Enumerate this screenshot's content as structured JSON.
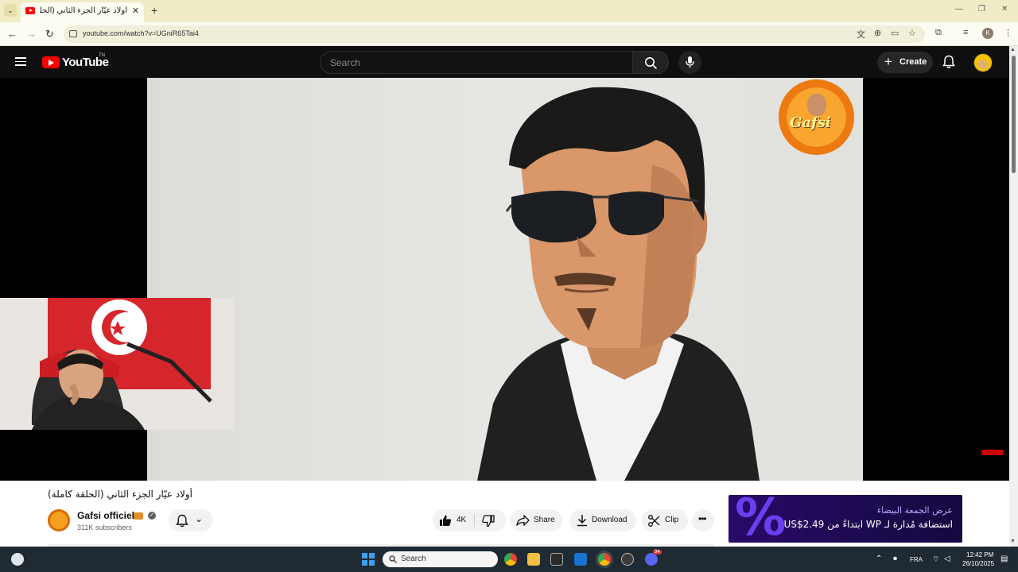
{
  "browser": {
    "tab_title": "أولاد عيّار الجزء الثاني (الحلقة",
    "tab_close": "✕",
    "new_tab": "+",
    "url": "youtube.com/watch?v=UGniR65Tai4",
    "profile_initial": "K",
    "window_controls": [
      "—",
      "❐",
      "✕"
    ]
  },
  "yt_header": {
    "logo_text": "YouTube",
    "logo_country": "TN",
    "search_placeholder": "Search",
    "create_label": "Create"
  },
  "player": {
    "watermark_text": "Gafsi"
  },
  "video": {
    "title": "أولاد عيّار الجزء الثاني (الحلقة كاملة)",
    "channel_name": "Gafsi officiel",
    "subscribers": "311K subscribers",
    "likes": "4K",
    "share_label": "Share",
    "download_label": "Download",
    "clip_label": "Clip"
  },
  "ad": {
    "headline": "عرض الجمعة البيضاء",
    "body": "استضافة مُدارة لـ WP ابتداءً من US$2.49"
  },
  "taskbar": {
    "search_label": "Search",
    "language": "FRA",
    "time": "12:42 PM",
    "date": "26/10/2025",
    "notification_badge": "34"
  },
  "colors": {
    "youtube_red": "#ff0000",
    "header_bg": "#0f0f0f",
    "ad_bg": "#1c0a4f",
    "taskbar_bg": "#1f2a33"
  }
}
